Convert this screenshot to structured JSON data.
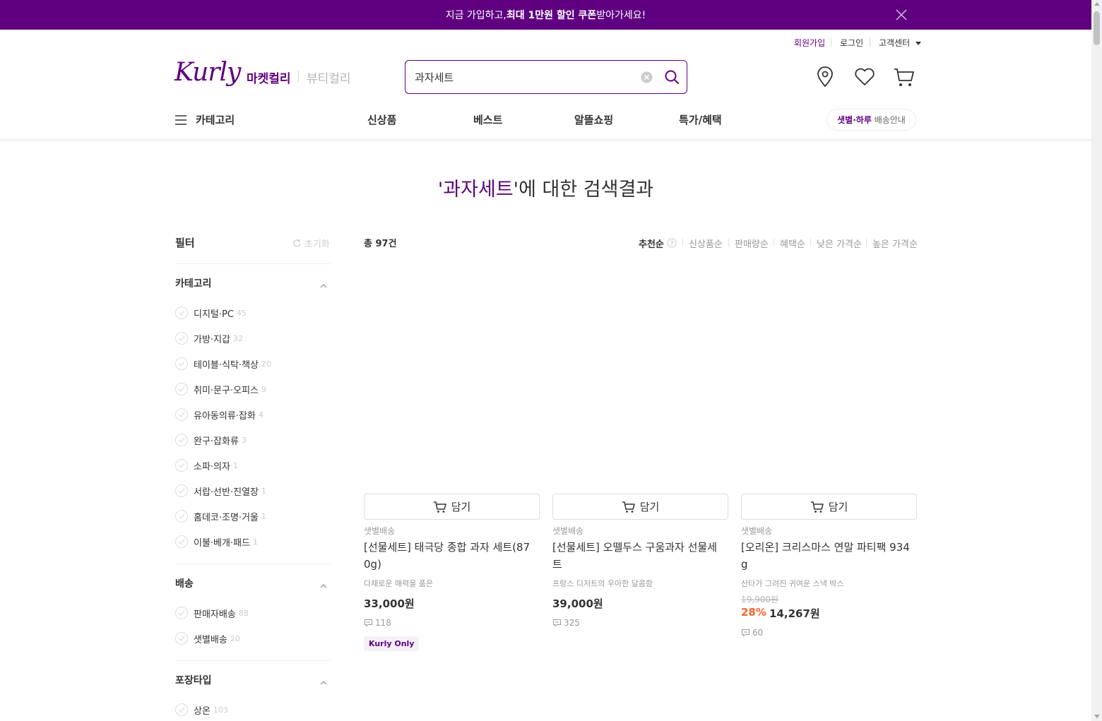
{
  "banner": {
    "text_pre": "지금 가입하고, ",
    "text_bold": "최대 1만원 할인 쿠폰",
    "text_post": " 받아가세요!"
  },
  "user_menu": {
    "signup": "회원가입",
    "login": "로그인",
    "support": "고객센터"
  },
  "header": {
    "logo": "Kurly",
    "mall_market": "마켓컬리",
    "mall_beauty": "뷰티컬리",
    "search_value": "과자세트",
    "delivery_pill_strong": "샛별·하루",
    "delivery_pill_rest": " 배송안내"
  },
  "nav": {
    "category": "카테고리",
    "items": [
      "신상품",
      "베스트",
      "알뜰쇼핑",
      "특가/혜택"
    ]
  },
  "result": {
    "quote_open": "'",
    "keyword": "과자세트",
    "suffix": "'에 대한 검색결과"
  },
  "filter": {
    "title": "필터",
    "reset": "초기화",
    "groups": [
      {
        "title": "카테고리",
        "items": [
          {
            "label": "디지털·PC",
            "count": "45"
          },
          {
            "label": "가방·지갑",
            "count": "32"
          },
          {
            "label": "테이블·식탁·책상",
            "count": "20"
          },
          {
            "label": "취미·문구·오피스",
            "count": "9"
          },
          {
            "label": "유아동의류·잡화",
            "count": "4"
          },
          {
            "label": "완구·잡화류",
            "count": "3"
          },
          {
            "label": "소파·의자",
            "count": "1"
          },
          {
            "label": "서랍·선반·진열장",
            "count": "1"
          },
          {
            "label": "홈데코·조명·거울",
            "count": "1"
          },
          {
            "label": "이불·베개·패드",
            "count": "1"
          }
        ]
      },
      {
        "title": "배송",
        "items": [
          {
            "label": "판매자배송",
            "count": "88"
          },
          {
            "label": "샛별배송",
            "count": "20"
          }
        ]
      },
      {
        "title": "포장타입",
        "items": [
          {
            "label": "상온",
            "count": "103"
          }
        ]
      }
    ]
  },
  "list": {
    "total": "총 97건",
    "sorts": [
      "추천순",
      "신상품순",
      "판매량순",
      "혜택순",
      "낮은 가격순",
      "높은 가격순"
    ]
  },
  "products": [
    {
      "cart_label": "담기",
      "delivery": "샛별배송",
      "name_line1": "[선물세트] 태극당 종합 과자 세트(87",
      "name_line2": "0g)",
      "desc": "다채로운 매력을 품은",
      "price": "33,000원",
      "reviews": "118",
      "badge": "Kurly Only"
    },
    {
      "cart_label": "담기",
      "delivery": "샛별배송",
      "name_line1": "[선물세트] 오뗄두스 구움과자 선물세",
      "name_line2": "트",
      "desc": "프랑스 디저트의 우아한 달콤함",
      "price": "39,000원",
      "reviews": "325"
    },
    {
      "cart_label": "담기",
      "delivery": "샛별배송",
      "name_line1": "[오리온] 크리스마스 연말 파티팩 934",
      "name_line2": "g",
      "desc": "산타가 그려진 귀여운 스낵 박스",
      "original_price": "19,900원",
      "discount": "28%",
      "price": "14,267원",
      "reviews": "60"
    }
  ],
  "colors": {
    "brand": "#5f0080",
    "discount": "#fa622f"
  }
}
